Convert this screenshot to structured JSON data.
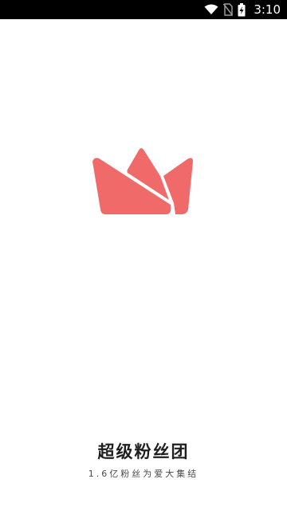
{
  "status_bar": {
    "time": "3:10",
    "icons": [
      "wifi-icon",
      "no-sim-icon",
      "battery-charging-icon"
    ]
  },
  "splash": {
    "logo_icon": "crown-logo-icon",
    "brand_color": "#F06A6A",
    "app_name": "超级粉丝团",
    "slogan": "1.6亿粉丝为爱大集结"
  },
  "colors": {
    "status_bar_bg": "#000000",
    "page_bg": "#FFFFFF",
    "title_text": "#1F1F1F",
    "slogan_text": "#4A4A4A"
  }
}
